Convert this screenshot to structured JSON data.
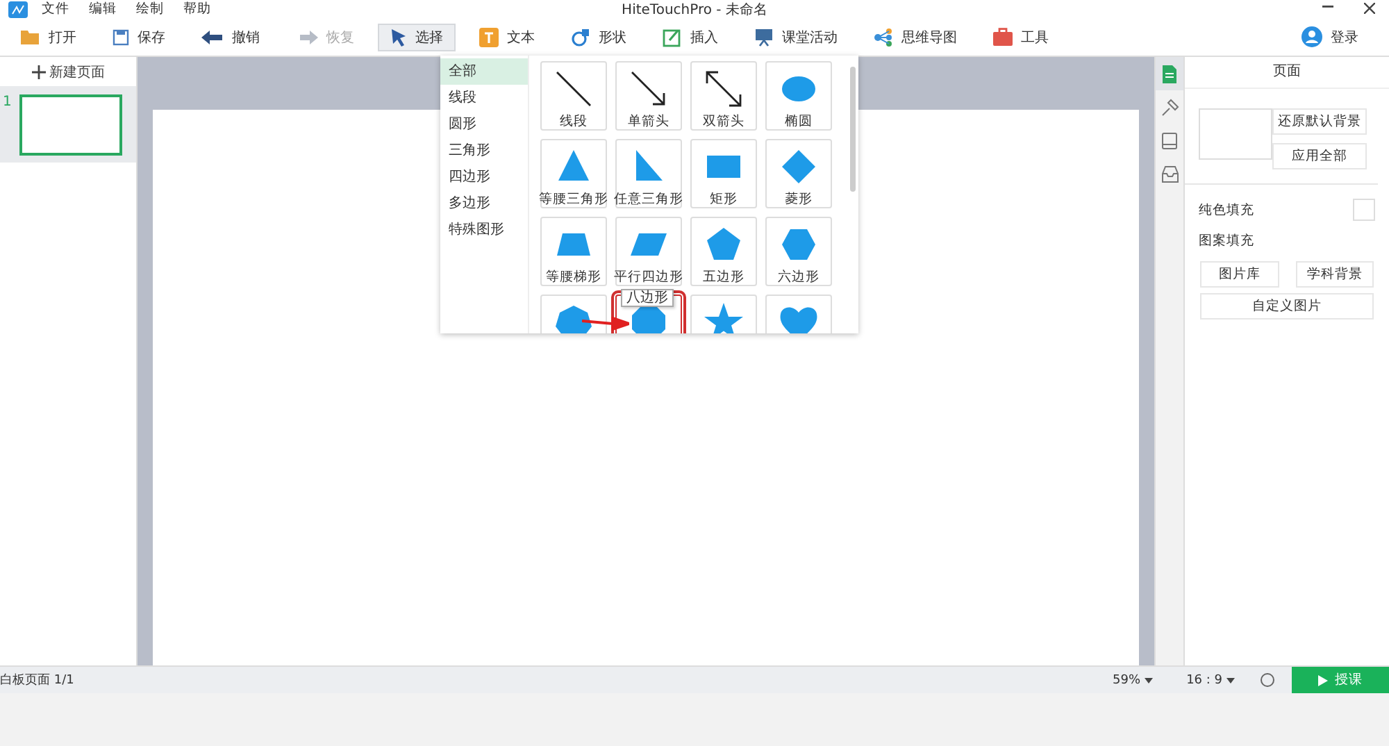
{
  "menu": [
    "文件",
    "编辑",
    "绘制",
    "帮助"
  ],
  "window": {
    "title": "HiteTouchPro - 未命名"
  },
  "toolbar": [
    {
      "kind": "open",
      "label": "打开",
      "disabled": false,
      "selected": false
    },
    {
      "kind": "save",
      "label": "保存",
      "disabled": false,
      "selected": false
    },
    {
      "kind": "undo",
      "label": "撤销",
      "disabled": false,
      "selected": false
    },
    {
      "kind": "redo",
      "label": "恢复",
      "disabled": true,
      "selected": false
    },
    {
      "kind": "select",
      "label": "选择",
      "disabled": false,
      "selected": true
    },
    {
      "kind": "text",
      "label": "文本",
      "disabled": false,
      "selected": false
    },
    {
      "kind": "shape",
      "label": "形状",
      "disabled": false,
      "selected": false
    },
    {
      "kind": "insert",
      "label": "插入",
      "disabled": false,
      "selected": false
    },
    {
      "kind": "activity",
      "label": "课堂活动",
      "disabled": false,
      "selected": false
    },
    {
      "kind": "mindmap",
      "label": "思维导图",
      "disabled": false,
      "selected": false
    },
    {
      "kind": "tools",
      "label": "工具",
      "disabled": false,
      "selected": false
    }
  ],
  "user": {
    "label": "登录"
  },
  "pages": {
    "new_page": "新建页面",
    "thumbnails": [
      {
        "number": "1",
        "selected": true
      }
    ]
  },
  "shape_picker": {
    "categories": [
      {
        "label": "全部",
        "selected": true
      },
      {
        "label": "线段",
        "selected": false
      },
      {
        "label": "圆形",
        "selected": false
      },
      {
        "label": "三角形",
        "selected": false
      },
      {
        "label": "四边形",
        "selected": false
      },
      {
        "label": "多边形",
        "selected": false
      },
      {
        "label": "特殊图形",
        "selected": false
      }
    ],
    "shapes": [
      {
        "kind": "line",
        "label": "线段",
        "highlighted": false
      },
      {
        "kind": "arrow",
        "label": "单箭头",
        "highlighted": false
      },
      {
        "kind": "double-arrow",
        "label": "双箭头",
        "highlighted": false
      },
      {
        "kind": "ellipse",
        "label": "椭圆",
        "highlighted": false
      },
      {
        "kind": "isosceles-triangle",
        "label": "等腰三角形",
        "highlighted": false
      },
      {
        "kind": "right-triangle",
        "label": "任意三角形",
        "highlighted": false
      },
      {
        "kind": "rectangle",
        "label": "矩形",
        "highlighted": false
      },
      {
        "kind": "diamond",
        "label": "菱形",
        "highlighted": false
      },
      {
        "kind": "trapezoid",
        "label": "等腰梯形",
        "highlighted": false
      },
      {
        "kind": "parallelogram",
        "label": "平行四边形",
        "highlighted": false
      },
      {
        "kind": "pentagon",
        "label": "五边形",
        "highlighted": false
      },
      {
        "kind": "hexagon",
        "label": "六边形",
        "highlighted": false
      },
      {
        "kind": "heptagon",
        "highlighted": false
      },
      {
        "kind": "octagon",
        "highlighted": true
      },
      {
        "kind": "star",
        "highlighted": false
      },
      {
        "kind": "heart",
        "highlighted": false
      }
    ],
    "tooltip": "八边形"
  },
  "right_tabs": [
    {
      "kind": "page",
      "selected": true
    },
    {
      "kind": "pin",
      "selected": false
    },
    {
      "kind": "layer",
      "selected": false
    },
    {
      "kind": "tray",
      "selected": false
    }
  ],
  "page_panel": {
    "title": "页面",
    "restore_button": "还原默认背景",
    "apply_all_button": "应用全部",
    "solid_fill": "纯色填充",
    "pattern_fill": "图案填充",
    "buttons": [
      "图片库",
      "学科背景",
      "自定义图片"
    ]
  },
  "status_bar": {
    "page_info": "白板页面 1/1",
    "zoom": "59%",
    "ratio": "16 : 9",
    "start_button": "授课"
  }
}
